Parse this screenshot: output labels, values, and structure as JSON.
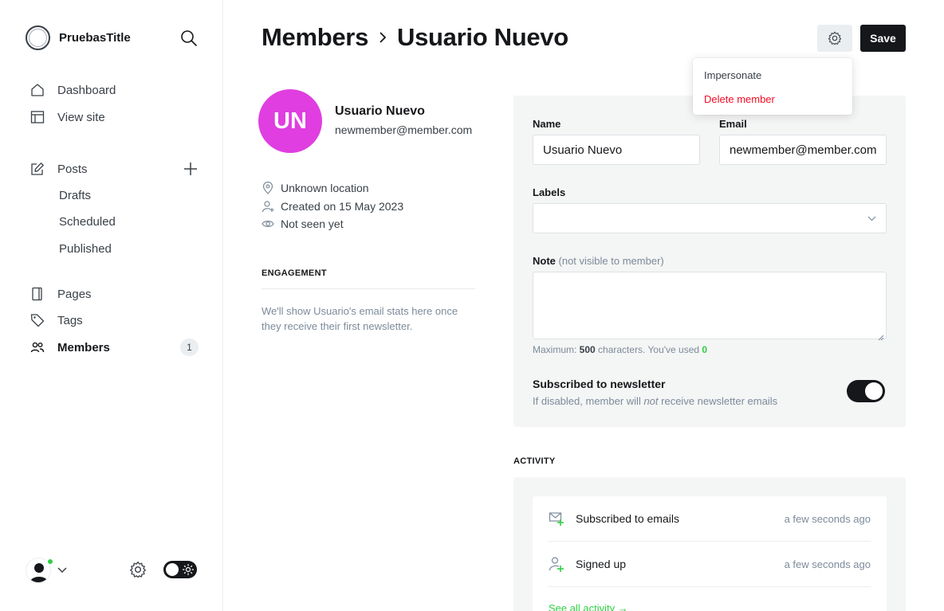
{
  "sidebar": {
    "brand_title": "PruebasTitle",
    "nav": {
      "dashboard": "Dashboard",
      "view_site": "View site",
      "posts": "Posts",
      "drafts": "Drafts",
      "scheduled": "Scheduled",
      "published": "Published",
      "pages": "Pages",
      "tags": "Tags",
      "members": "Members",
      "members_count": "1"
    }
  },
  "header": {
    "breadcrumb_parent": "Members",
    "breadcrumb_current": "Usuario Nuevo",
    "save_label": "Save"
  },
  "settings_menu": {
    "impersonate": "Impersonate",
    "delete_member": "Delete member"
  },
  "profile": {
    "initials": "UN",
    "avatar_color": "#e03ee0",
    "name": "Usuario Nuevo",
    "email": "newmember@member.com",
    "location": "Unknown location",
    "created": "Created on 15 May 2023",
    "last_seen": "Not seen yet"
  },
  "engagement": {
    "heading": "ENGAGEMENT",
    "text": "We'll show Usuario's email stats here once they receive their first newsletter."
  },
  "form": {
    "name_label": "Name",
    "name_value": "Usuario Nuevo",
    "email_label": "Email",
    "email_value": "newmember@member.com",
    "labels_label": "Labels",
    "note_label": "Note",
    "note_hint": "(not visible to member)",
    "counter_prefix": "Maximum: ",
    "counter_max": "500",
    "counter_middle": " characters. You've used ",
    "counter_used": "0",
    "subscribed_title": "Subscribed to newsletter",
    "subscribed_desc_1": "If disabled, member will ",
    "subscribed_desc_em": "not",
    "subscribed_desc_2": " receive newsletter emails",
    "subscribed": true
  },
  "activity": {
    "heading": "ACTIVITY",
    "items": [
      {
        "label": "Subscribed to emails",
        "time": "a few seconds ago",
        "icon": "email-plus-icon"
      },
      {
        "label": "Signed up",
        "time": "a few seconds ago",
        "icon": "user-plus-icon"
      }
    ],
    "see_all": "See all activity →"
  },
  "colors": {
    "accent_green": "#30cf43",
    "danger_red": "#f50b23",
    "dark": "#15171a"
  }
}
